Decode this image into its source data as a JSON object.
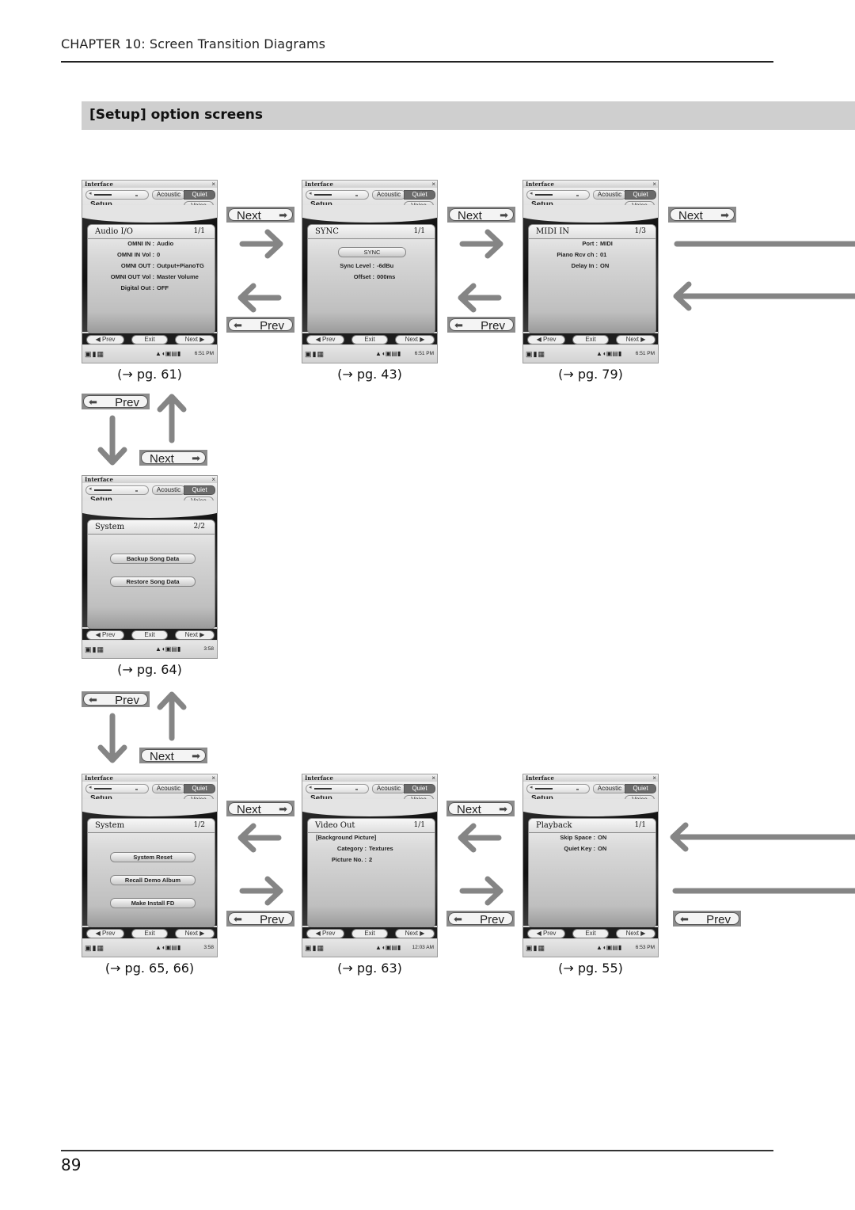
{
  "header": {
    "chapter": "CHAPTER 10: Screen Transition Diagrams",
    "section_title": "[Setup] option screens"
  },
  "footer": {
    "page_number": "89"
  },
  "common": {
    "window_title": "Interface",
    "close": "×",
    "acoustic": "Acoustic",
    "quiet": "Quiet",
    "setup": "Setup",
    "voice": "Voice",
    "prev": "Prev",
    "exit": "Exit",
    "next": "Next",
    "speaker_icon": "◂",
    "left_status_icons": "▣▮▦",
    "right_status_icons": "▲◖▣▤▮"
  },
  "transition_labels": {
    "next": "Next",
    "prev": "Prev",
    "next_arrow": "➡",
    "prev_arrow": "⬅"
  },
  "screens": [
    {
      "id": "audio-io",
      "title": "Audio I/O",
      "page": "1/1",
      "time": "6:51 PM",
      "ref": "(→ pg. 61)",
      "rows": [
        {
          "label": "OMNI IN :",
          "value": "Audio"
        },
        {
          "label": "OMNI IN Vol :",
          "value": "0"
        },
        {
          "label": "OMNI OUT :",
          "value": "Output+PianoTG"
        },
        {
          "label": "OMNI OUT Vol :",
          "value": "Master Volume"
        },
        {
          "label": "Digital Out :",
          "value": "OFF"
        }
      ]
    },
    {
      "id": "sync",
      "title": "SYNC",
      "page": "1/1",
      "time": "6:51 PM",
      "ref": "(→ pg. 43)",
      "button": "SYNC",
      "rows": [
        {
          "label": "Sync Level :",
          "value": "-6dBu"
        },
        {
          "label": "Offset :",
          "value": "000ms"
        }
      ]
    },
    {
      "id": "midi-in",
      "title": "MIDI IN",
      "page": "1/3",
      "time": "6:51 PM",
      "ref": "(→ pg. 79)",
      "rows": [
        {
          "label": "Port :",
          "value": "MIDI"
        },
        {
          "label": "Piano Rcv ch :",
          "value": "01"
        },
        {
          "label": "Delay In :",
          "value": "ON"
        }
      ]
    },
    {
      "id": "system-2",
      "title": "System",
      "page": "2/2",
      "time": "3:58",
      "ref": "(→ pg. 64)",
      "buttons": [
        "Backup Song Data",
        "Restore Song Data"
      ]
    },
    {
      "id": "system-1",
      "title": "System",
      "page": "1/2",
      "time": "3:58",
      "ref": "(→ pg. 65, 66)",
      "buttons": [
        "System Reset",
        "Recall Demo Album",
        "Make Install FD"
      ]
    },
    {
      "id": "video-out",
      "title": "Video Out",
      "page": "1/1",
      "time": "12:03 AM",
      "ref": "(→ pg. 63)",
      "subheading": "[Background Picture]",
      "rows": [
        {
          "label": "Category :",
          "value": "Textures"
        },
        {
          "label": "Picture No. :",
          "value": "2"
        }
      ]
    },
    {
      "id": "playback",
      "title": "Playback",
      "page": "1/1",
      "time": "6:53 PM",
      "ref": "(→ pg. 55)",
      "rows": [
        {
          "label": "Skip Space :",
          "value": "ON"
        },
        {
          "label": "Quiet Key :",
          "value": "ON"
        }
      ]
    }
  ]
}
